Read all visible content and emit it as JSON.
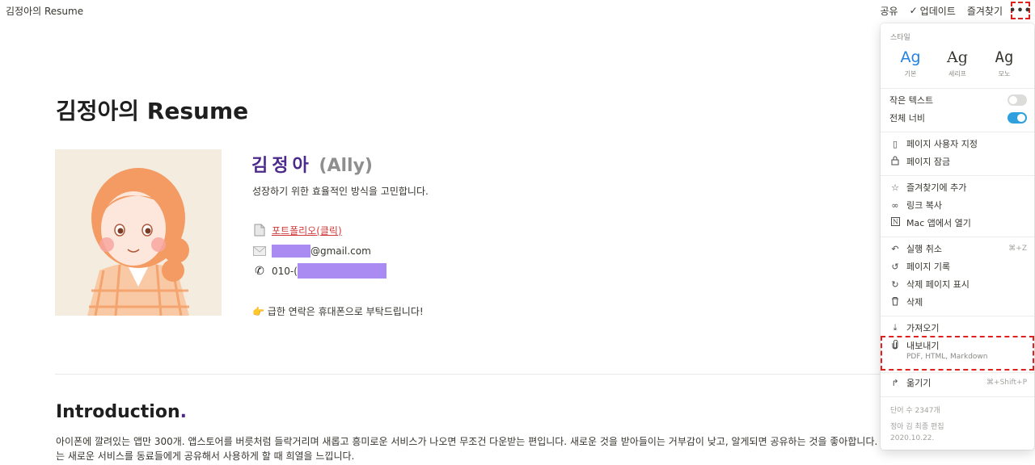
{
  "topbar": {
    "breadcrumb": "김정아의 Resume",
    "share": "공유",
    "updates": "업데이트",
    "favorite": "즐겨찾기",
    "more": "•••"
  },
  "page": {
    "title": "김정아의 Resume",
    "name_ko": "김정아",
    "name_en": "(Ally)",
    "tagline": "성장하기 위한 효율적인 방식을 고민합니다.",
    "portfolio_link": "포트폴리오(클릭)",
    "email_suffix": "@gmail.com",
    "phone_prefix": "010-(",
    "note_emoji": "👉",
    "note": "급한 연락은 휴대폰으로 부탁드립니다!",
    "intro_heading": "Introduction",
    "intro_dot": ".",
    "intro_line1": "아이폰에 깔려있는 앱만 300개. 앱스토어를 버릇처럼 들락거리며 새롭고 흥미로운 서비스가 나오면 무조건 다운받는 편입니다. 새로운 것을 받아들이는 거부감이 낮고, 알게되면 공유하는 것을 좋아합니다. 그래서",
    "intro_line2": "는 새로운 서비스를 동료들에게 공유해서 사용하게 할 때 희열을 느낍니다."
  },
  "menu": {
    "style_label": "스타일",
    "styles": [
      {
        "glyph": "Ag",
        "caption": "기본",
        "selected": true
      },
      {
        "glyph": "Ag",
        "caption": "세리프",
        "selected": false
      },
      {
        "glyph": "Ag",
        "caption": "모노",
        "selected": false
      }
    ],
    "small_text": "작은 텍스트",
    "small_text_on": false,
    "full_width": "전체 너비",
    "full_width_on": true,
    "customize_page": "페이지 사용자 지정",
    "lock_page": "페이지 잠금",
    "add_favorite": "즐겨찾기에 추가",
    "copy_link": "링크 복사",
    "open_mac": "Mac 앱에서 열기",
    "undo": "실행 취소",
    "undo_shortcut": "⌘+Z",
    "page_history": "페이지 기록",
    "show_deleted": "삭제 페이지 표시",
    "delete": "삭제",
    "import": "가져오기",
    "export": "내보내기",
    "export_sub": "PDF, HTML, Markdown",
    "move": "옮기기",
    "move_shortcut": "⌘+Shift+P",
    "word_count": "단어 수 2347개",
    "last_edited_by": "정아 김 최종 편집",
    "last_edited_date": "2020.10.22."
  },
  "colors": {
    "accent_purple": "#4b2a8c",
    "link_red": "#d23a3a",
    "redaction": "#a98bf2",
    "toggle_on": "#2ea0dd",
    "highlight_box": "#e0201c"
  }
}
